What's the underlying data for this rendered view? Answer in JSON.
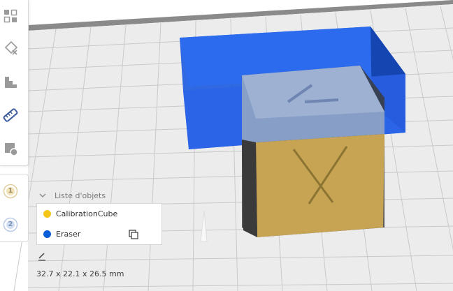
{
  "scene": {
    "build_plate_color": "#ececec",
    "grid_line_color": "#c8c8c8",
    "eraser_color": "#2a64e6",
    "cube_color": "#c7a453",
    "ghost_color": "#8aa3cc"
  },
  "toolbar": {
    "tools": [
      {
        "name": "arrange-icon"
      },
      {
        "name": "scale-icon"
      },
      {
        "name": "support-blocker-icon"
      },
      {
        "name": "measure-icon"
      },
      {
        "name": "per-model-settings-icon"
      }
    ],
    "active_tool": "measure-icon"
  },
  "extruders": [
    {
      "number": "1",
      "color": "#f2c42d"
    },
    {
      "number": "2",
      "color": "#4a8fe0"
    }
  ],
  "object_list": {
    "header": "Liste d'objets",
    "items": [
      {
        "name": "CalibrationCube",
        "color": "#f5c518"
      },
      {
        "name": "Eraser",
        "color": "#0b5ed7"
      }
    ]
  },
  "dimensions": "32.7 x 22.1 x 26.5 mm"
}
